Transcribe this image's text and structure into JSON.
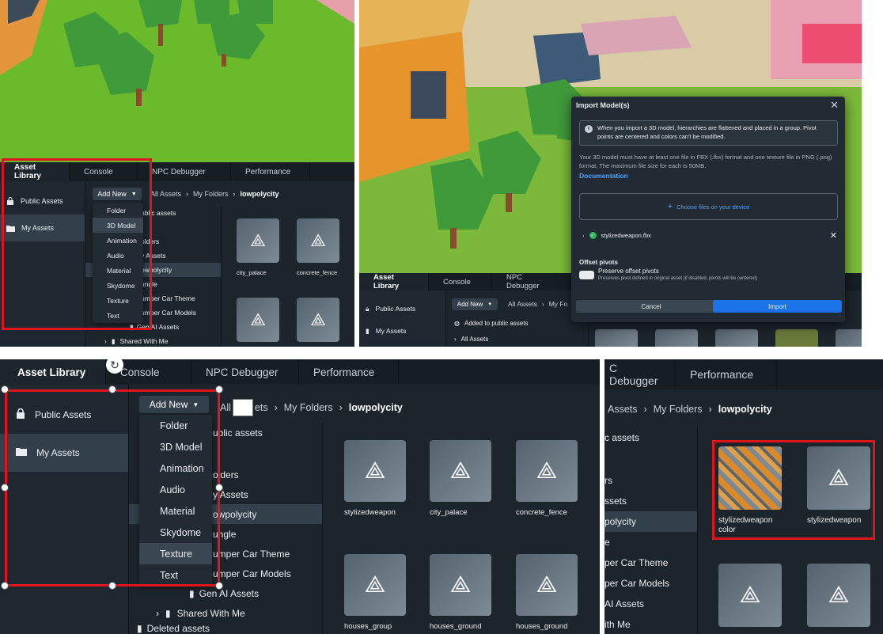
{
  "p1": {
    "tabs": [
      "Asset Library",
      "Console",
      "NPC Debugger",
      "Performance"
    ],
    "side": [
      "Public Assets",
      "My Assets"
    ],
    "add_new": "Add New",
    "crumbs": [
      "All Assets",
      "My Folders",
      "lowpolycity"
    ],
    "menu": [
      "Folder",
      "3D Model",
      "Animation",
      "Audio",
      "Material",
      "Skydome",
      "Texture",
      "Text"
    ],
    "tree": [
      "ublic assets",
      "olders",
      "y Assets",
      "owpolycity",
      "ungle",
      "umper Car Theme",
      "umper Car Models",
      "Gen AI Assets",
      "Shared With Me"
    ],
    "cards": [
      "city_palace",
      "concrete_fence"
    ]
  },
  "p2": {
    "dialog_title": "Import Model(s)",
    "info": "When you import a 3D model, hierarchies are flattened and placed in a group. Pivot points are centered and colors can't be modified.",
    "req": "Your 3D model must have at least one file in FBX (.fbx) format and one texture file in PNG (.png) format. The maximum file size for each is 50MB.",
    "doc_link": "Documentation",
    "choose": "Choose files on your device",
    "file": "stylizedweapon.fbx",
    "offset_title": "Offset pivots",
    "offset_label": "Preserve offset pivots",
    "offset_desc": "Preserves pivot defined in original asset (if disabled, pivots will be centered)",
    "cancel": "Cancel",
    "import": "Import",
    "tabs": [
      "Asset Library",
      "Console",
      "NPC Debugger"
    ],
    "side": [
      "Public Assets",
      "My Assets"
    ],
    "add_new": "Add New",
    "crumbs": [
      "All Assets",
      "My Fo"
    ],
    "tree": [
      "Added to public assets",
      "All Assets"
    ]
  },
  "p3": {
    "tabs": [
      "Asset Library",
      "Console",
      "NPC Debugger",
      "Performance"
    ],
    "side": [
      "Public Assets",
      "My Assets"
    ],
    "add_new": "Add New",
    "crumbs": [
      "All",
      "ets",
      "My Folders",
      "lowpolycity"
    ],
    "menu": [
      "Folder",
      "3D Model",
      "Animation",
      "Audio",
      "Material",
      "Skydome",
      "Texture",
      "Text"
    ],
    "tree": [
      "ublic assets",
      "olders",
      "y Assets",
      "owpolycity",
      "ungle",
      "umper Car Theme",
      "umper Car Models",
      "Gen AI Assets",
      "Shared With Me",
      "Deleted assets"
    ],
    "cards": [
      "stylizedweapon",
      "city_palace",
      "concrete_fence",
      "houses_group",
      "houses_ground",
      "houses_ground"
    ]
  },
  "p4": {
    "tabs": [
      "C Debugger",
      "Performance"
    ],
    "crumbs": [
      "Assets",
      "My Folders",
      "lowpolycity"
    ],
    "tree": [
      "c assets",
      "rs",
      "ssets",
      "polycity",
      "e",
      "per Car Theme",
      "per Car Models",
      "AI Assets",
      "ith Me"
    ],
    "cards": [
      "stylizedweapon color",
      "stylizedweapon"
    ]
  },
  "colors": {
    "red": "#e0141e",
    "blue": "#1a73e8",
    "grass": "#6fbf2e"
  }
}
